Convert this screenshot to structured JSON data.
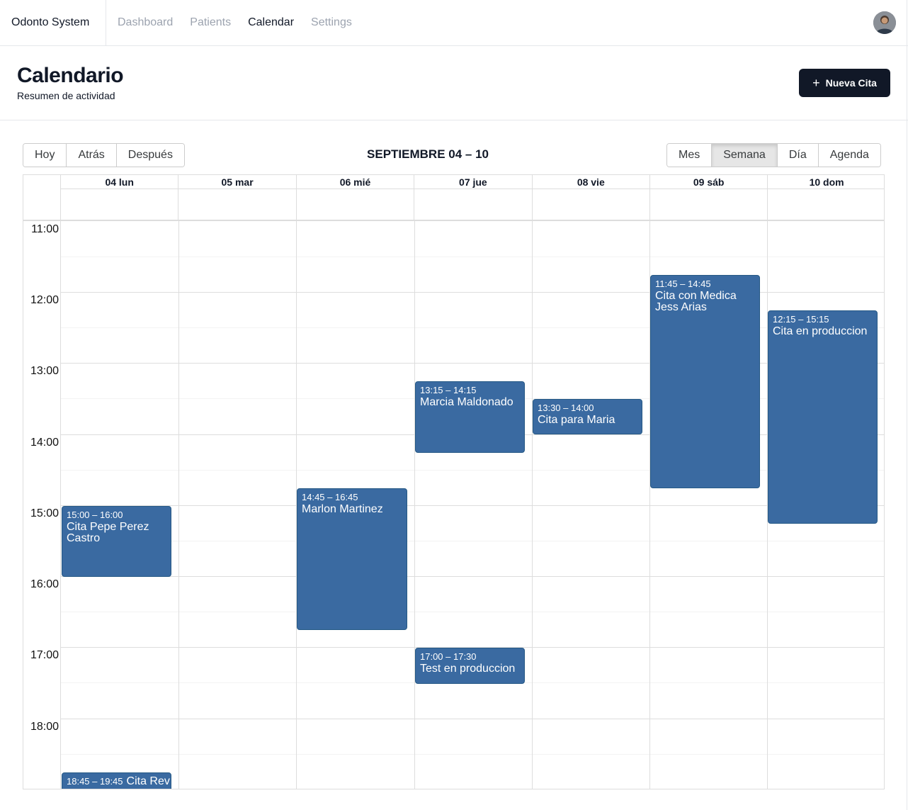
{
  "nav": {
    "brand": "Odonto System",
    "links": [
      {
        "label": "Dashboard",
        "active": false
      },
      {
        "label": "Patients",
        "active": false
      },
      {
        "label": "Calendar",
        "active": true
      },
      {
        "label": "Settings",
        "active": false
      }
    ]
  },
  "header": {
    "title": "Calendario",
    "subtitle": "Resumen de actividad",
    "new_button": "Nueva Cita"
  },
  "toolbar": {
    "today": "Hoy",
    "back": "Atrás",
    "next": "Después",
    "range": "SEPTIEMBRE 04 – 10",
    "views": {
      "month": "Mes",
      "week": "Semana",
      "day": "Día",
      "agenda": "Agenda"
    },
    "active_view": "Semana"
  },
  "calendar": {
    "days": [
      "04 lun",
      "05 mar",
      "06 mié",
      "07 jue",
      "08 vie",
      "09 sáb",
      "10 dom"
    ],
    "hours": [
      "11:00",
      "12:00",
      "13:00",
      "14:00",
      "15:00",
      "16:00",
      "17:00",
      "18:00"
    ],
    "events": [
      {
        "time": "15:00 – 16:00",
        "title": "Cita Pepe Perez Castro"
      },
      {
        "time": "18:45 – 19:45",
        "title": "Cita Rev Salcedo"
      },
      {
        "time": "14:45 – 16:45",
        "title": "Marlon Martinez"
      },
      {
        "time": "13:15 – 14:15",
        "title": "Marcia Maldonado"
      },
      {
        "time": "17:00 – 17:30",
        "title": "Test en produccion"
      },
      {
        "time": "13:30 – 14:00",
        "title": "Cita para Maria"
      },
      {
        "time": "11:45 – 14:45",
        "title": "Cita con Medica Jess Arias"
      },
      {
        "time": "12:15 – 15:15",
        "title": "Cita en produccion"
      }
    ],
    "event_color": "#3a6aa1"
  }
}
